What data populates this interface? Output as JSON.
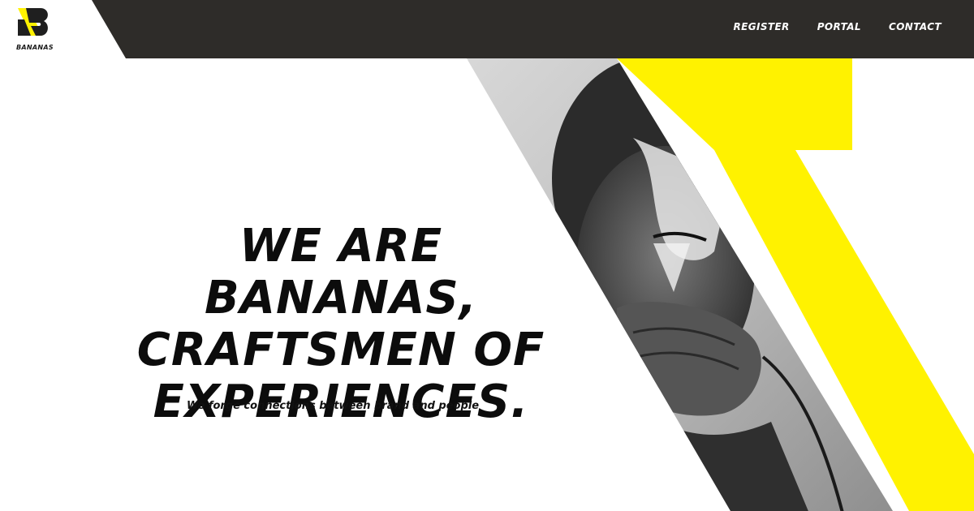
{
  "brand": {
    "logo_text": "BANANAS"
  },
  "nav": {
    "items": [
      {
        "label": "REGISTER"
      },
      {
        "label": "PORTAL"
      },
      {
        "label": "CONTACT"
      }
    ]
  },
  "hero": {
    "headline_lines": [
      "WE ARE BANANAS,",
      "CRAFTSMEN OF",
      "EXPERIENCES."
    ],
    "subline": "We forge connections between brand and people"
  },
  "colors": {
    "topbar": "#2e2c29",
    "accent_yellow": "#fff200",
    "text": "#0c0c0c",
    "background": "#ffffff"
  },
  "icons": {
    "logo": "bananas-b-logo-icon",
    "hero_image": "photo-man-with-microphone"
  }
}
